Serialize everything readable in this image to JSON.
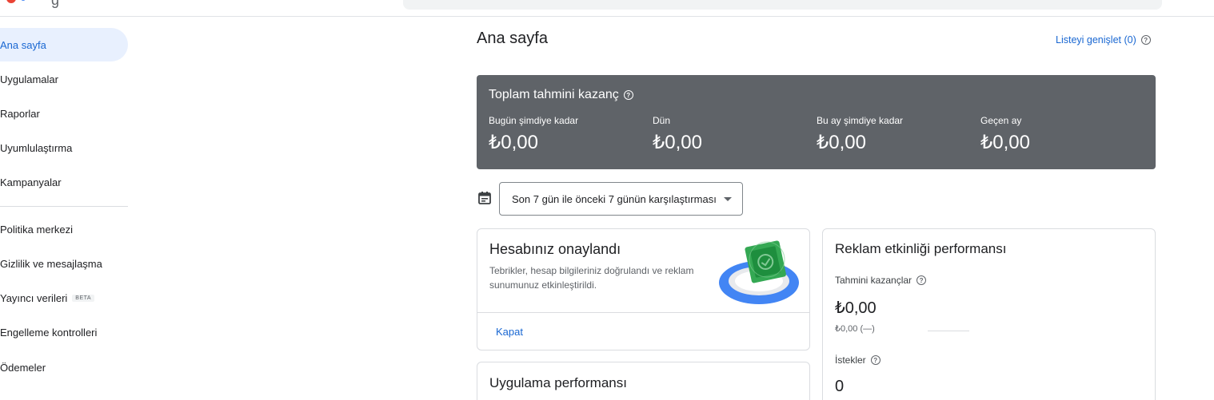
{
  "header": {
    "logo_text": "g"
  },
  "sidebar": {
    "items": [
      {
        "label": "Ana sayfa"
      },
      {
        "label": "Uygulamalar"
      },
      {
        "label": "Raporlar"
      },
      {
        "label": "Uyumlulaştırma"
      },
      {
        "label": "Kampanyalar"
      },
      {
        "label": "Politika merkezi"
      },
      {
        "label": "Gizlilik ve mesajlaşma"
      },
      {
        "label": "Yayıncı verileri",
        "badge": "BETA"
      },
      {
        "label": "Engelleme kontrolleri"
      },
      {
        "label": "Ödemeler"
      }
    ]
  },
  "main": {
    "title": "Ana sayfa",
    "expand_link": "Listeyi genişlet (0)",
    "earnings": {
      "title": "Toplam tahmini kazanç",
      "columns": [
        {
          "label": "Bugün şimdiye kadar",
          "value": "₺0,00"
        },
        {
          "label": "Dün",
          "value": "₺0,00"
        },
        {
          "label": "Bu ay şimdiye kadar",
          "value": "₺0,00"
        },
        {
          "label": "Geçen ay",
          "value": "₺0,00"
        }
      ]
    },
    "date_range": "Son 7 gün ile önceki 7 günün karşılaştırması",
    "approved_card": {
      "title": "Hesabınız onaylandı",
      "text": "Tebrikler, hesap bilgileriniz doğrulandı ve reklam sunumunuz etkinleştirildi.",
      "dismiss": "Kapat"
    },
    "apps_card": {
      "title": "Uygulama performansı"
    },
    "perf_card": {
      "title": "Reklam etkinliği performansı",
      "earnings_label": "Tahmini kazançlar",
      "earnings_value": "₺0,00",
      "earnings_sub": "₺0,00 (—)",
      "requests_label": "İstekler",
      "requests_value": "0"
    }
  },
  "colors": {
    "accent": "#1967d2",
    "active_nav_bg": "#e8f0fe",
    "earnings_bg": "#5f6368"
  }
}
